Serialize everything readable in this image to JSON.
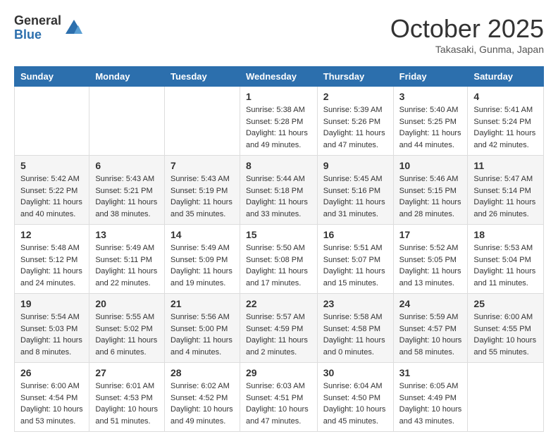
{
  "header": {
    "logo_general": "General",
    "logo_blue": "Blue",
    "month_title": "October 2025",
    "location": "Takasaki, Gunma, Japan"
  },
  "days_of_week": [
    "Sunday",
    "Monday",
    "Tuesday",
    "Wednesday",
    "Thursday",
    "Friday",
    "Saturday"
  ],
  "weeks": [
    [
      {
        "day": "",
        "info": ""
      },
      {
        "day": "",
        "info": ""
      },
      {
        "day": "",
        "info": ""
      },
      {
        "day": "1",
        "info": "Sunrise: 5:38 AM\nSunset: 5:28 PM\nDaylight: 11 hours and 49 minutes."
      },
      {
        "day": "2",
        "info": "Sunrise: 5:39 AM\nSunset: 5:26 PM\nDaylight: 11 hours and 47 minutes."
      },
      {
        "day": "3",
        "info": "Sunrise: 5:40 AM\nSunset: 5:25 PM\nDaylight: 11 hours and 44 minutes."
      },
      {
        "day": "4",
        "info": "Sunrise: 5:41 AM\nSunset: 5:24 PM\nDaylight: 11 hours and 42 minutes."
      }
    ],
    [
      {
        "day": "5",
        "info": "Sunrise: 5:42 AM\nSunset: 5:22 PM\nDaylight: 11 hours and 40 minutes."
      },
      {
        "day": "6",
        "info": "Sunrise: 5:43 AM\nSunset: 5:21 PM\nDaylight: 11 hours and 38 minutes."
      },
      {
        "day": "7",
        "info": "Sunrise: 5:43 AM\nSunset: 5:19 PM\nDaylight: 11 hours and 35 minutes."
      },
      {
        "day": "8",
        "info": "Sunrise: 5:44 AM\nSunset: 5:18 PM\nDaylight: 11 hours and 33 minutes."
      },
      {
        "day": "9",
        "info": "Sunrise: 5:45 AM\nSunset: 5:16 PM\nDaylight: 11 hours and 31 minutes."
      },
      {
        "day": "10",
        "info": "Sunrise: 5:46 AM\nSunset: 5:15 PM\nDaylight: 11 hours and 28 minutes."
      },
      {
        "day": "11",
        "info": "Sunrise: 5:47 AM\nSunset: 5:14 PM\nDaylight: 11 hours and 26 minutes."
      }
    ],
    [
      {
        "day": "12",
        "info": "Sunrise: 5:48 AM\nSunset: 5:12 PM\nDaylight: 11 hours and 24 minutes."
      },
      {
        "day": "13",
        "info": "Sunrise: 5:49 AM\nSunset: 5:11 PM\nDaylight: 11 hours and 22 minutes."
      },
      {
        "day": "14",
        "info": "Sunrise: 5:49 AM\nSunset: 5:09 PM\nDaylight: 11 hours and 19 minutes."
      },
      {
        "day": "15",
        "info": "Sunrise: 5:50 AM\nSunset: 5:08 PM\nDaylight: 11 hours and 17 minutes."
      },
      {
        "day": "16",
        "info": "Sunrise: 5:51 AM\nSunset: 5:07 PM\nDaylight: 11 hours and 15 minutes."
      },
      {
        "day": "17",
        "info": "Sunrise: 5:52 AM\nSunset: 5:05 PM\nDaylight: 11 hours and 13 minutes."
      },
      {
        "day": "18",
        "info": "Sunrise: 5:53 AM\nSunset: 5:04 PM\nDaylight: 11 hours and 11 minutes."
      }
    ],
    [
      {
        "day": "19",
        "info": "Sunrise: 5:54 AM\nSunset: 5:03 PM\nDaylight: 11 hours and 8 minutes."
      },
      {
        "day": "20",
        "info": "Sunrise: 5:55 AM\nSunset: 5:02 PM\nDaylight: 11 hours and 6 minutes."
      },
      {
        "day": "21",
        "info": "Sunrise: 5:56 AM\nSunset: 5:00 PM\nDaylight: 11 hours and 4 minutes."
      },
      {
        "day": "22",
        "info": "Sunrise: 5:57 AM\nSunset: 4:59 PM\nDaylight: 11 hours and 2 minutes."
      },
      {
        "day": "23",
        "info": "Sunrise: 5:58 AM\nSunset: 4:58 PM\nDaylight: 11 hours and 0 minutes."
      },
      {
        "day": "24",
        "info": "Sunrise: 5:59 AM\nSunset: 4:57 PM\nDaylight: 10 hours and 58 minutes."
      },
      {
        "day": "25",
        "info": "Sunrise: 6:00 AM\nSunset: 4:55 PM\nDaylight: 10 hours and 55 minutes."
      }
    ],
    [
      {
        "day": "26",
        "info": "Sunrise: 6:00 AM\nSunset: 4:54 PM\nDaylight: 10 hours and 53 minutes."
      },
      {
        "day": "27",
        "info": "Sunrise: 6:01 AM\nSunset: 4:53 PM\nDaylight: 10 hours and 51 minutes."
      },
      {
        "day": "28",
        "info": "Sunrise: 6:02 AM\nSunset: 4:52 PM\nDaylight: 10 hours and 49 minutes."
      },
      {
        "day": "29",
        "info": "Sunrise: 6:03 AM\nSunset: 4:51 PM\nDaylight: 10 hours and 47 minutes."
      },
      {
        "day": "30",
        "info": "Sunrise: 6:04 AM\nSunset: 4:50 PM\nDaylight: 10 hours and 45 minutes."
      },
      {
        "day": "31",
        "info": "Sunrise: 6:05 AM\nSunset: 4:49 PM\nDaylight: 10 hours and 43 minutes."
      },
      {
        "day": "",
        "info": ""
      }
    ]
  ]
}
